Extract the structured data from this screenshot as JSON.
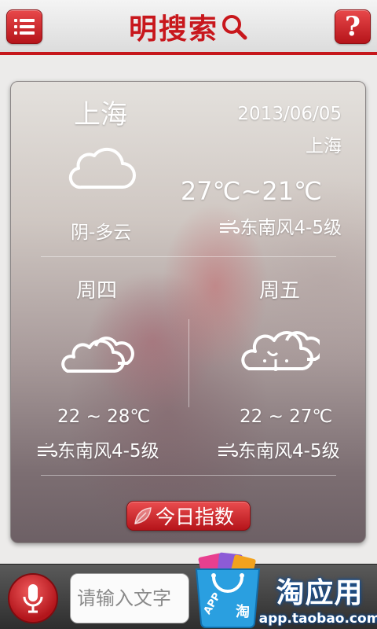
{
  "header": {
    "brand": "明搜索",
    "help_label": "?"
  },
  "today": {
    "city": "上海",
    "date": "2013/06/05",
    "city_sub": "上海",
    "temperature": "27℃~21℃",
    "condition": "阴-多云",
    "wind": "东南风4-5级",
    "icon": "cloud-icon"
  },
  "forecast": [
    {
      "day": "周四",
      "range": "22 ~ 28℃",
      "wind": "东南风4-5级",
      "icon": "cloudy-icon"
    },
    {
      "day": "周五",
      "range": "22 ~ 27℃",
      "wind": "东南风4-5级",
      "icon": "rain-cloud-icon"
    }
  ],
  "index_button": "今日指数",
  "bottom": {
    "input_placeholder": "请输入文字",
    "ad_title": "淘应用",
    "ad_url": "app.taobao.com",
    "bag_text_app": "APP",
    "bag_text_tao": "淘"
  },
  "colors": {
    "brand_red": "#c8171c",
    "header_bg": "#e6e6e6",
    "bottom_bar": "#3b3b3b",
    "ad_blue": "#1a6fd1"
  }
}
